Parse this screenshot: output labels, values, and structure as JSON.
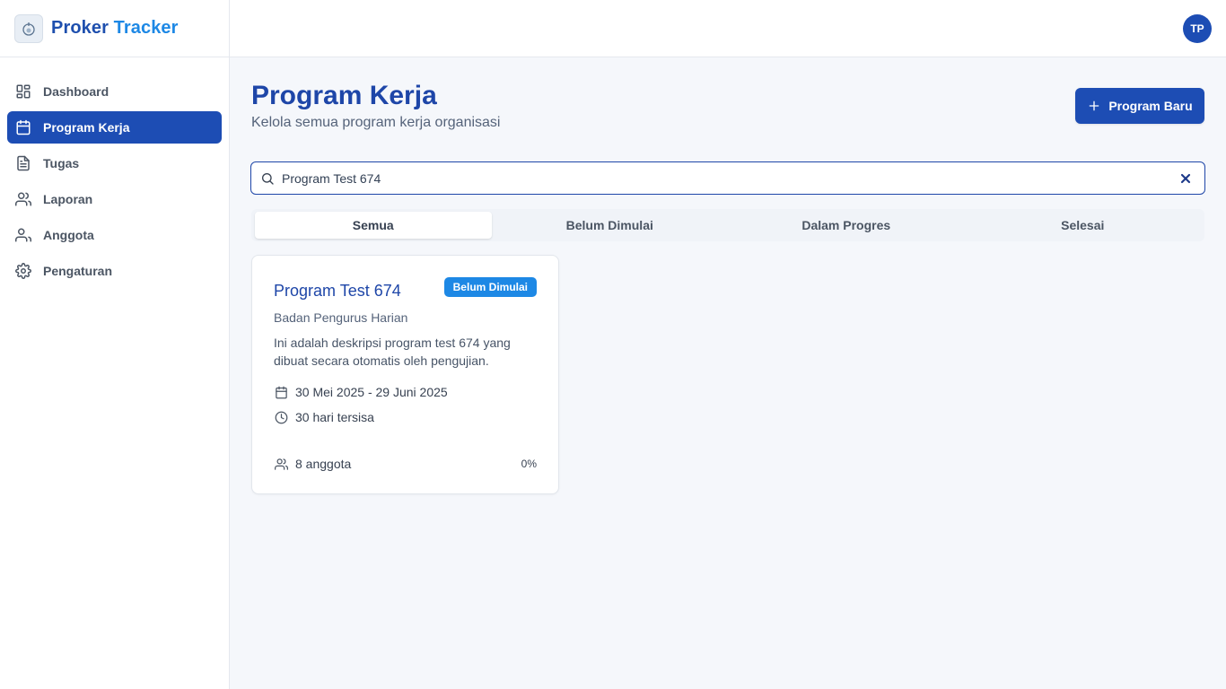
{
  "brand": {
    "title_main": "Proker",
    "title_accent": "Tracker"
  },
  "sidebar": {
    "items": [
      {
        "label": "Dashboard",
        "icon": "dashboard-icon"
      },
      {
        "label": "Program Kerja",
        "icon": "calendar-icon",
        "active": true
      },
      {
        "label": "Tugas",
        "icon": "file-icon"
      },
      {
        "label": "Laporan",
        "icon": "users-icon"
      },
      {
        "label": "Anggota",
        "icon": "user-icon"
      },
      {
        "label": "Pengaturan",
        "icon": "gear-icon"
      }
    ]
  },
  "header": {
    "avatar_initials": "TP"
  },
  "page": {
    "title": "Program Kerja",
    "subtitle": "Kelola semua program kerja organisasi",
    "new_button": "Program Baru"
  },
  "search": {
    "value": "Program Test 674",
    "placeholder": ""
  },
  "tabs": [
    {
      "label": "Semua",
      "active": true
    },
    {
      "label": "Belum Dimulai"
    },
    {
      "label": "Dalam Progres"
    },
    {
      "label": "Selesai"
    }
  ],
  "cards": [
    {
      "title": "Program Test 674",
      "status": "Belum Dimulai",
      "organization": "Badan Pengurus Harian",
      "description": "Ini adalah deskripsi program test 674 yang dibuat secara otomatis oleh pengujian.",
      "date_range": "30 Mei 2025 - 29 Juni 2025",
      "remaining": "30 hari tersisa",
      "members": "8 anggota",
      "progress": "0%"
    }
  ],
  "colors": {
    "primary": "#1d4db4",
    "accent": "#1d88e5",
    "title": "#1e46a8"
  }
}
